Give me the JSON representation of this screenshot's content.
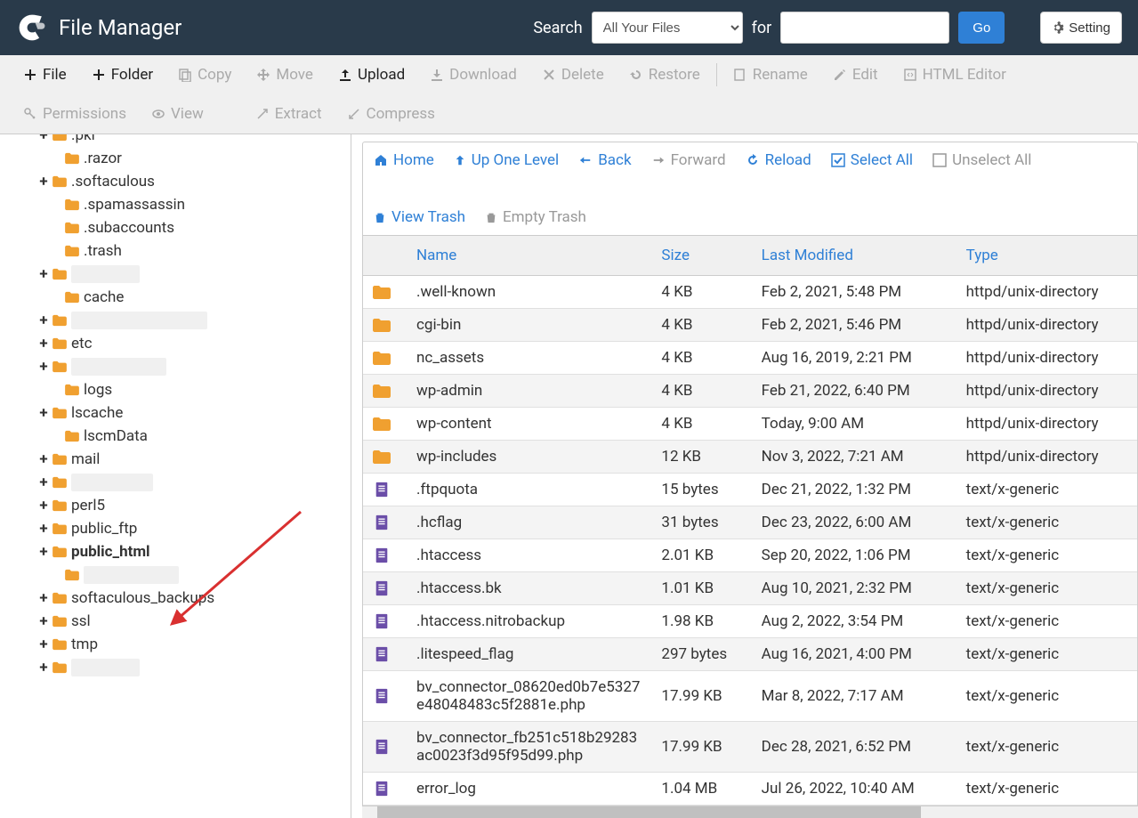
{
  "header": {
    "app_title": "File Manager",
    "search_label": "Search",
    "search_scope": "All Your Files",
    "for_label": "for",
    "go_label": "Go",
    "settings_label": "Setting"
  },
  "toolbar": {
    "file": "File",
    "folder": "Folder",
    "copy": "Copy",
    "move": "Move",
    "upload": "Upload",
    "download": "Download",
    "delete": "Delete",
    "restore": "Restore",
    "rename": "Rename",
    "edit": "Edit",
    "html_editor": "HTML Editor",
    "permissions": "Permissions",
    "view": "View",
    "extract": "Extract",
    "compress": "Compress"
  },
  "breadcrumb": {
    "home": "Home",
    "up": "Up One Level",
    "back": "Back",
    "forward": "Forward",
    "reload": "Reload",
    "select_all": "Select All",
    "unselect_all": "Unselect All",
    "view_trash": "View Trash",
    "empty_trash": "Empty Trash"
  },
  "tree": [
    {
      "toggle": "+",
      "label": ".pki",
      "indent": 0,
      "redacted": false,
      "bold": false,
      "partial": true
    },
    {
      "toggle": "",
      "label": ".razor",
      "indent": 1,
      "redacted": false,
      "bold": false
    },
    {
      "toggle": "+",
      "label": ".softaculous",
      "indent": 0,
      "redacted": false,
      "bold": false
    },
    {
      "toggle": "",
      "label": ".spamassassin",
      "indent": 1,
      "redacted": false,
      "bold": false
    },
    {
      "toggle": "",
      "label": ".subaccounts",
      "indent": 1,
      "redacted": false,
      "bold": false
    },
    {
      "toggle": "",
      "label": ".trash",
      "indent": 1,
      "redacted": false,
      "bold": false
    },
    {
      "toggle": "+",
      "label": "__________",
      "indent": 0,
      "redacted": true,
      "bold": false
    },
    {
      "toggle": "",
      "label": "cache",
      "indent": 1,
      "redacted": false,
      "bold": false
    },
    {
      "toggle": "+",
      "label": "____________________",
      "indent": 0,
      "redacted": true,
      "bold": false
    },
    {
      "toggle": "+",
      "label": "etc",
      "indent": 0,
      "redacted": false,
      "bold": false
    },
    {
      "toggle": "+",
      "label": "______________",
      "indent": 0,
      "redacted": true,
      "bold": false
    },
    {
      "toggle": "",
      "label": "logs",
      "indent": 1,
      "redacted": false,
      "bold": false
    },
    {
      "toggle": "+",
      "label": "lscache",
      "indent": 0,
      "redacted": false,
      "bold": false
    },
    {
      "toggle": "",
      "label": "lscmData",
      "indent": 1,
      "redacted": false,
      "bold": false
    },
    {
      "toggle": "+",
      "label": "mail",
      "indent": 0,
      "redacted": false,
      "bold": false
    },
    {
      "toggle": "+",
      "label": "____________",
      "indent": 0,
      "redacted": true,
      "bold": false
    },
    {
      "toggle": "+",
      "label": "perl5",
      "indent": 0,
      "redacted": false,
      "bold": false
    },
    {
      "toggle": "+",
      "label": "public_ftp",
      "indent": 0,
      "redacted": false,
      "bold": false
    },
    {
      "toggle": "+",
      "label": "public_html",
      "indent": 0,
      "redacted": false,
      "bold": true
    },
    {
      "toggle": "",
      "label": "______________",
      "indent": 1,
      "redacted": true,
      "bold": false
    },
    {
      "toggle": "+",
      "label": "softaculous_backups",
      "indent": 0,
      "redacted": false,
      "bold": false
    },
    {
      "toggle": "+",
      "label": "ssl",
      "indent": 0,
      "redacted": false,
      "bold": false
    },
    {
      "toggle": "+",
      "label": "tmp",
      "indent": 0,
      "redacted": false,
      "bold": false
    },
    {
      "toggle": "+",
      "label": "__________",
      "indent": 0,
      "redacted": true,
      "bold": false
    }
  ],
  "table": {
    "columns": {
      "name": "Name",
      "size": "Size",
      "modified": "Last Modified",
      "type": "Type"
    },
    "rows": [
      {
        "icon": "folder",
        "name": ".well-known",
        "size": "4 KB",
        "modified": "Feb 2, 2021, 5:48 PM",
        "type": "httpd/unix-directory"
      },
      {
        "icon": "folder",
        "name": "cgi-bin",
        "size": "4 KB",
        "modified": "Feb 2, 2021, 5:46 PM",
        "type": "httpd/unix-directory"
      },
      {
        "icon": "folder",
        "name": "nc_assets",
        "size": "4 KB",
        "modified": "Aug 16, 2019, 2:21 PM",
        "type": "httpd/unix-directory"
      },
      {
        "icon": "folder",
        "name": "wp-admin",
        "size": "4 KB",
        "modified": "Feb 21, 2022, 6:40 PM",
        "type": "httpd/unix-directory"
      },
      {
        "icon": "folder",
        "name": "wp-content",
        "size": "4 KB",
        "modified": "Today, 9:00 AM",
        "type": "httpd/unix-directory"
      },
      {
        "icon": "folder",
        "name": "wp-includes",
        "size": "12 KB",
        "modified": "Nov 3, 2022, 7:21 AM",
        "type": "httpd/unix-directory"
      },
      {
        "icon": "file",
        "name": ".ftpquota",
        "size": "15 bytes",
        "modified": "Dec 21, 2022, 1:32 PM",
        "type": "text/x-generic"
      },
      {
        "icon": "file",
        "name": ".hcflag",
        "size": "31 bytes",
        "modified": "Dec 23, 2022, 6:00 AM",
        "type": "text/x-generic"
      },
      {
        "icon": "file",
        "name": ".htaccess",
        "size": "2.01 KB",
        "modified": "Sep 20, 2022, 1:06 PM",
        "type": "text/x-generic"
      },
      {
        "icon": "file",
        "name": ".htaccess.bk",
        "size": "1.01 KB",
        "modified": "Aug 10, 2021, 2:32 PM",
        "type": "text/x-generic"
      },
      {
        "icon": "file",
        "name": ".htaccess.nitrobackup",
        "size": "1.98 KB",
        "modified": "Aug 2, 2022, 3:54 PM",
        "type": "text/x-generic"
      },
      {
        "icon": "file",
        "name": ".litespeed_flag",
        "size": "297 bytes",
        "modified": "Aug 16, 2021, 4:00 PM",
        "type": "text/x-generic"
      },
      {
        "icon": "file",
        "name": "bv_connector_08620ed0b7e5327e48048483c5f2881e.php",
        "size": "17.99 KB",
        "modified": "Mar 8, 2022, 7:17 AM",
        "type": "text/x-generic"
      },
      {
        "icon": "file",
        "name": "bv_connector_fb251c518b29283ac0023f3d95f95d99.php",
        "size": "17.99 KB",
        "modified": "Dec 28, 2021, 6:52 PM",
        "type": "text/x-generic"
      },
      {
        "icon": "file",
        "name": "error_log",
        "size": "1.04 MB",
        "modified": "Jul 26, 2022, 10:40 AM",
        "type": "text/x-generic"
      }
    ]
  }
}
